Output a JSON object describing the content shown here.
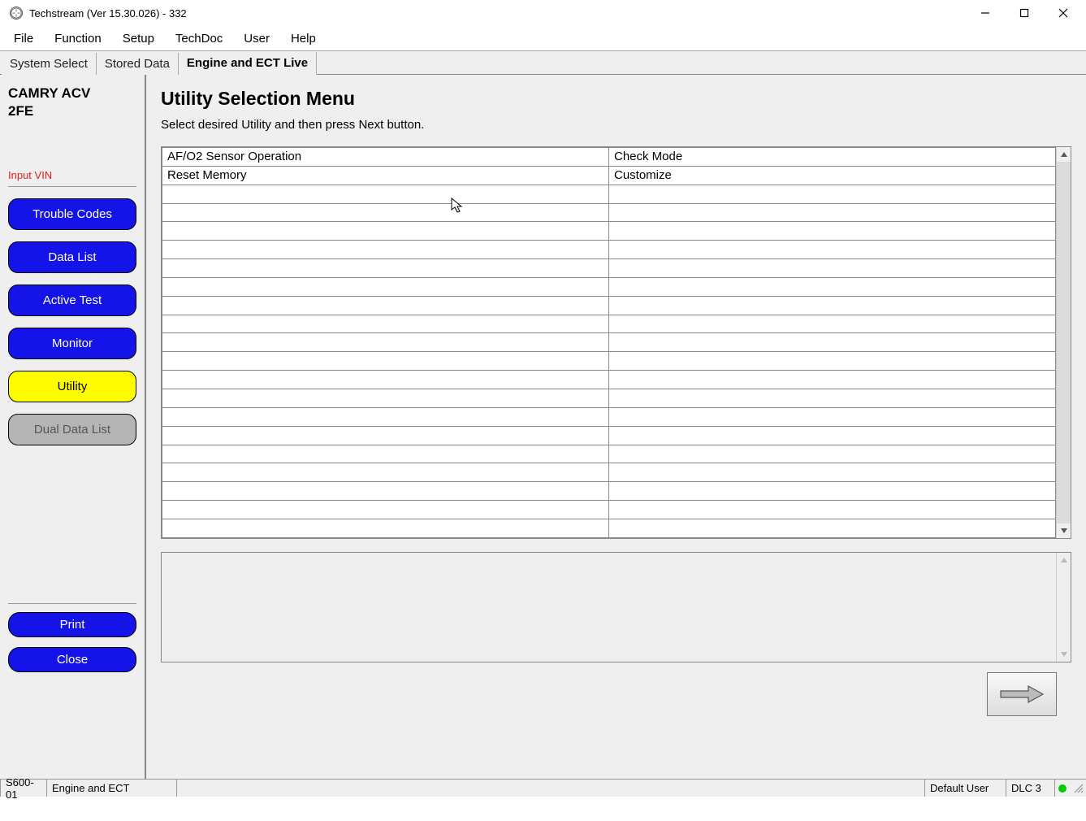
{
  "window": {
    "title": "Techstream (Ver 15.30.026) - 332"
  },
  "menu": {
    "items": [
      "File",
      "Function",
      "Setup",
      "TechDoc",
      "User",
      "Help"
    ]
  },
  "tabs": {
    "items": [
      {
        "label": "System Select",
        "active": false
      },
      {
        "label": "Stored Data",
        "active": false
      },
      {
        "label": "Engine and ECT Live",
        "active": true
      }
    ]
  },
  "sidebar": {
    "vehicle_line1": "CAMRY ACV",
    "vehicle_line2": "2FE",
    "input_vin": "Input VIN",
    "nav": [
      {
        "label": "Trouble Codes",
        "style": "blue"
      },
      {
        "label": "Data List",
        "style": "blue"
      },
      {
        "label": "Active Test",
        "style": "blue"
      },
      {
        "label": "Monitor",
        "style": "blue"
      },
      {
        "label": "Utility",
        "style": "yellow"
      },
      {
        "label": "Dual Data List",
        "style": "grey"
      }
    ],
    "print": "Print",
    "close": "Close"
  },
  "main": {
    "heading": "Utility Selection Menu",
    "instruction": "Select desired Utility and then press Next button.",
    "utilities": [
      [
        "AF/O2 Sensor Operation",
        "Check Mode"
      ],
      [
        "Reset Memory",
        "Customize"
      ]
    ],
    "total_rows": 21
  },
  "statusbar": {
    "code": "S600-01",
    "system": "Engine and ECT",
    "user": "Default User",
    "dlc": "DLC 3"
  }
}
